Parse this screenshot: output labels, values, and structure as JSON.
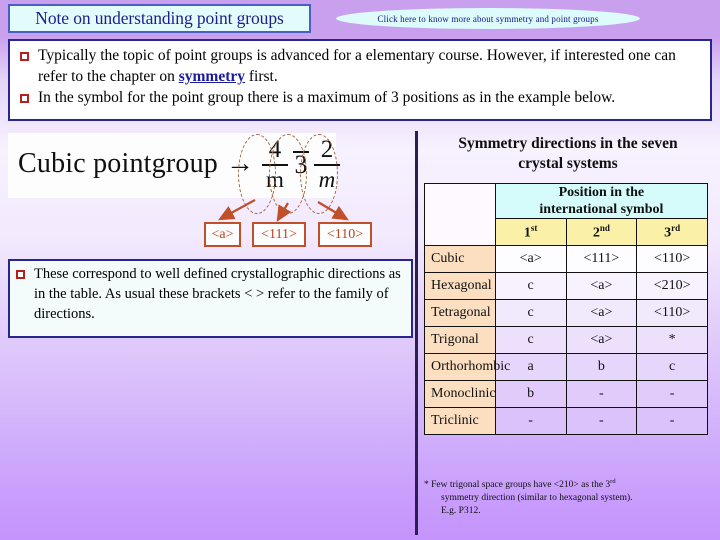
{
  "title": {
    "text": "Note on understanding point groups"
  },
  "link_oval": {
    "text": "Click here to know more about symmetry and point groups"
  },
  "main_bullets": [
    {
      "pre": "Typically the topic of point groups is advanced for a elementary course. However, if interested one can refer to the chapter on ",
      "link": "symmetry",
      "post": " first."
    },
    {
      "pre": "In the symbol for the point group there is a maximum of 3 positions as in the example below.",
      "link": "",
      "post": ""
    }
  ],
  "formula": {
    "lead": "Cubic pointgroup",
    "arrow": "→",
    "pos1_num": "4",
    "pos1_den": "m",
    "pos2_sym": "3",
    "pos3_num": "2",
    "pos3_den": "m"
  },
  "direction_boxes": [
    {
      "label": "<a>"
    },
    {
      "label": "<111>"
    },
    {
      "label": "<110>"
    }
  ],
  "note_bullet": {
    "text": "These correspond to well defined crystallographic directions as in the table. As usual these brackets < > refer to the family of directions."
  },
  "table": {
    "title_line1": "Symmetry directions in the seven",
    "title_line2": "crystal systems",
    "header_group": "Position in the international symbol",
    "header_group_line1": "Position in the",
    "header_group_line2": "international symbol",
    "ordinals": [
      {
        "num": "1",
        "sup": "st"
      },
      {
        "num": "2",
        "sup": "nd"
      },
      {
        "num": "3",
        "sup": "rd"
      }
    ],
    "rows": [
      {
        "system": "Cubic",
        "first": "<a>",
        "second": "<111>",
        "third": "<110>"
      },
      {
        "system": "Hexagonal",
        "first": "c",
        "second": "<a>",
        "third": "<210>"
      },
      {
        "system": "Tetragonal",
        "first": "c",
        "second": "<a>",
        "third": "<110>"
      },
      {
        "system": "Trigonal",
        "first": "c",
        "second": "<a>",
        "third": "*"
      },
      {
        "system": "Orthorhombic",
        "first": "a",
        "second": "b",
        "third": "c"
      },
      {
        "system": "Monoclinic",
        "first": "b",
        "second": "-",
        "third": "-"
      },
      {
        "system": "Triclinic",
        "first": "-",
        "second": "-",
        "third": "-"
      }
    ]
  },
  "footnote": {
    "line1_a": "* Few trigonal space groups  have <210> as the 3",
    "line1_sup": "rd",
    "line2": "symmetry direction (similar to hexagonal system).",
    "line3": "E.g. P312."
  },
  "colors": {
    "title_text": "#1e1e8c",
    "title_fill": "#e2fbfb",
    "title_border": "#4a5fc1",
    "bullet_square": "#b42020",
    "box_border": "#26268e",
    "direction_box": "#c0502a",
    "ellipse_dash": "#a8643c",
    "arrow": "#c0502a",
    "header_cyan": "#d6fbfb",
    "header_yellow": "#fbf0a8",
    "rowlabel_peach": "#fbdfc0",
    "background_top": "#c9a0ee",
    "background_bottom": "#c594fc"
  }
}
